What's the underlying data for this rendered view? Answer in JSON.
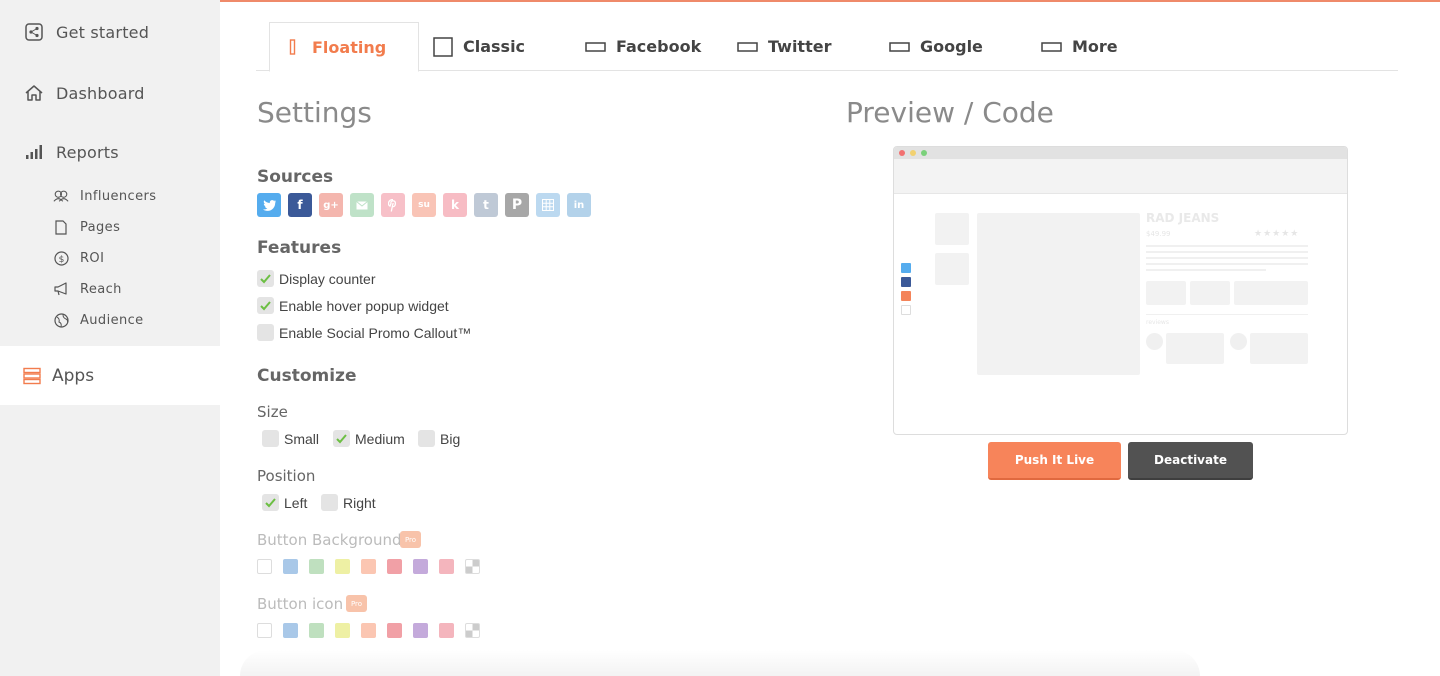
{
  "sidebar": {
    "items": [
      {
        "label": "Get started",
        "icon": "share-box-icon"
      },
      {
        "label": "Dashboard",
        "icon": "home-icon"
      },
      {
        "label": "Reports",
        "icon": "bar-chart-icon"
      }
    ],
    "report_children": [
      {
        "label": "Influencers",
        "icon": "people-icon"
      },
      {
        "label": "Pages",
        "icon": "page-icon"
      },
      {
        "label": "ROI",
        "icon": "dollar-icon"
      },
      {
        "label": "Reach",
        "icon": "megaphone-icon"
      },
      {
        "label": "Audience",
        "icon": "globe-icon"
      }
    ],
    "active_item": {
      "label": "Apps",
      "icon": "stack-icon"
    }
  },
  "tabs": [
    {
      "label": "Floating",
      "active": true
    },
    {
      "label": "Classic",
      "active": false
    },
    {
      "label": "Facebook",
      "active": false
    },
    {
      "label": "Twitter",
      "active": false
    },
    {
      "label": "Google",
      "active": false
    },
    {
      "label": "More",
      "active": false
    }
  ],
  "settings": {
    "title": "Settings",
    "sources_heading": "Sources",
    "sources": [
      {
        "name": "twitter",
        "glyph": "",
        "color": "#55acee"
      },
      {
        "name": "facebook",
        "glyph": "f",
        "color": "#3b5998"
      },
      {
        "name": "google-plus",
        "glyph": "g+",
        "color": "#f4b6ae"
      },
      {
        "name": "email",
        "glyph": "",
        "color": "#bfe2c8"
      },
      {
        "name": "pinterest",
        "glyph": "",
        "color": "#f7c0c8"
      },
      {
        "name": "stumbleupon",
        "glyph": "su",
        "color": "#f9c4b6"
      },
      {
        "name": "kik",
        "glyph": "k",
        "color": "#f7bcc4"
      },
      {
        "name": "tumblr",
        "glyph": "t",
        "color": "#bfc9d6"
      },
      {
        "name": "pocket",
        "glyph": "P",
        "color": "#a7a7a7"
      },
      {
        "name": "grid",
        "glyph": "",
        "color": "#bcd9f0"
      },
      {
        "name": "linkedin",
        "glyph": "in",
        "color": "#b3d2ea"
      }
    ],
    "features_heading": "Features",
    "features": [
      {
        "label": "Display counter",
        "checked": true
      },
      {
        "label": "Enable hover popup widget",
        "checked": true
      },
      {
        "label": "Enable Social Promo Callout™",
        "checked": false
      }
    ],
    "customize_heading": "Customize",
    "size_label": "Size",
    "sizes": [
      {
        "label": "Small",
        "checked": false
      },
      {
        "label": "Medium",
        "checked": true
      },
      {
        "label": "Big",
        "checked": false
      }
    ],
    "position_label": "Position",
    "positions": [
      {
        "label": "Left",
        "checked": true
      },
      {
        "label": "Right",
        "checked": false
      }
    ],
    "button_background_label": "Button Background",
    "button_icon_label": "Button icon",
    "pro_badge": "Pro",
    "swatch_colors": [
      "#ffffff",
      "#a9c8e8",
      "#bfe0bf",
      "#eef0a4",
      "#fbc6b2",
      "#f1a0a6",
      "#c4aadb",
      "#f4b5bd",
      "checker"
    ]
  },
  "preview": {
    "title": "Preview / Code",
    "mock_product_title": "RAD JEANS",
    "mock_price": "$49.99",
    "mock_stars": "★★★★★",
    "mock_reviews_label": "reviews",
    "push_live_label": "Push It Live",
    "deactivate_label": "Deactivate"
  },
  "colors": {
    "accent": "#f27c4d",
    "push_button": "#f7845a",
    "deactivate_button": "#525252"
  }
}
